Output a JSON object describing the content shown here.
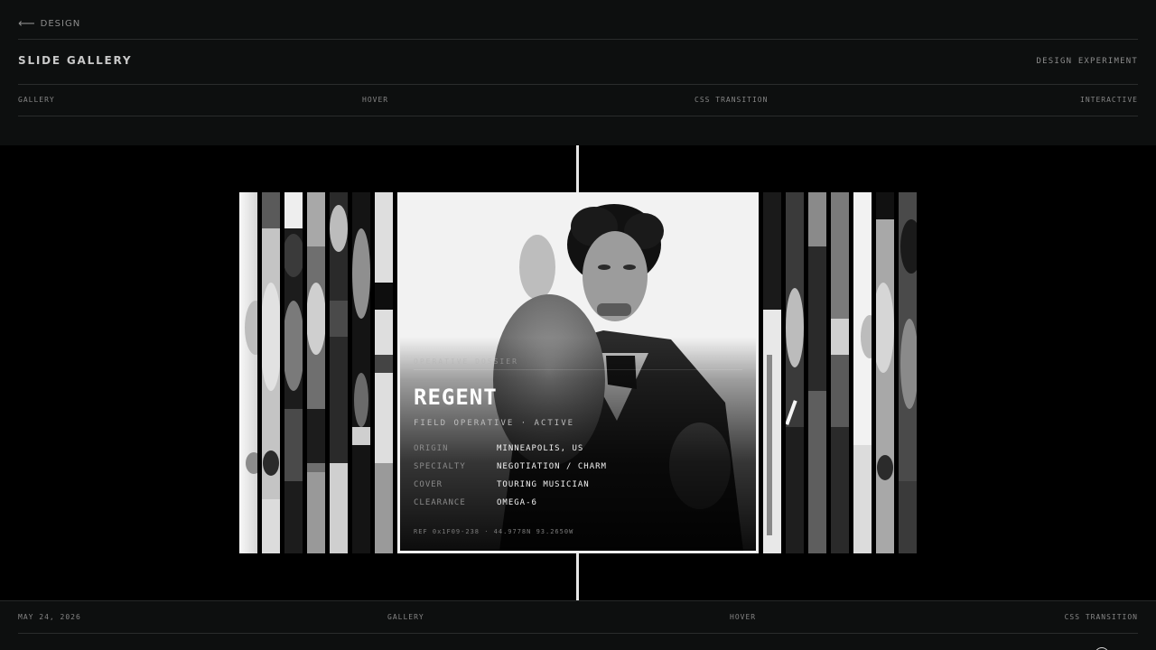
{
  "nav": {
    "back_label": "DESIGN",
    "back_icon": "arrow-left-icon"
  },
  "header": {
    "title": "SLIDE GALLERY",
    "kicker": "DESIGN EXPERIMENT",
    "tags": [
      "GALLERY",
      "HOVER",
      "CSS TRANSITION",
      "INTERACTIVE"
    ]
  },
  "gallery": {
    "strip_count_left": 7,
    "strip_count_right": 7,
    "feature": {
      "kicker": "OPERATIVE DOSSIER",
      "name": "REGENT",
      "subtitle": "FIELD OPERATIVE · ACTIVE",
      "fields": [
        {
          "key": "ORIGIN",
          "value": "MINNEAPOLIS, US"
        },
        {
          "key": "SPECIALTY",
          "value": "NEGOTIATION / CHARM"
        },
        {
          "key": "COVER",
          "value": "TOURING MUSICIAN"
        },
        {
          "key": "CLEARANCE",
          "value": "OMEGA-6"
        }
      ],
      "reference": "REF 0x1F09-238 · 44.9778N 93.2650W"
    }
  },
  "footer": {
    "date": "MAY 24, 2026",
    "tags": [
      "GALLERY",
      "HOVER",
      "CSS TRANSITION"
    ]
  },
  "colors": {
    "background": "#000000",
    "panel": "#0d0f0f",
    "accent": "#f2f2f2",
    "text_muted": "#8c8c8c"
  }
}
